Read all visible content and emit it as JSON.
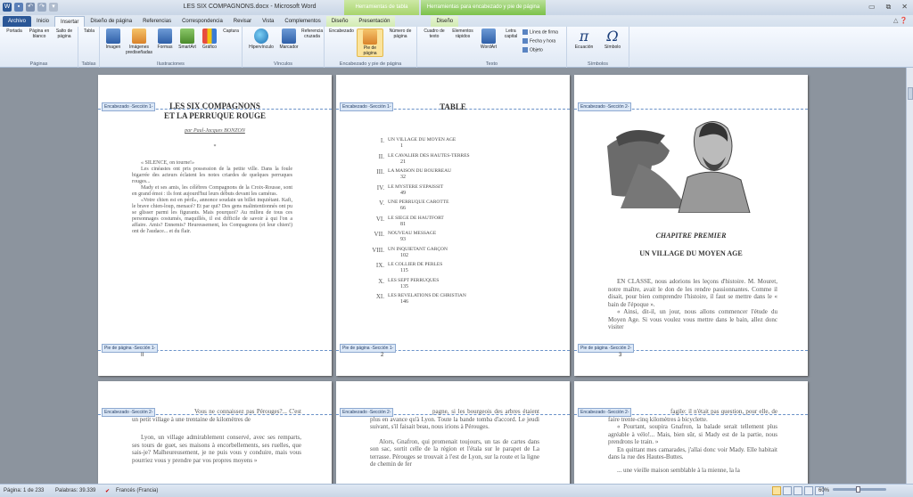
{
  "window": {
    "title": "LES SIX COMPAGNONS.docx - Microsoft Word",
    "context_tab_1": "Herramientas de tabla",
    "context_tab_2": "Herramientas para encabezado y pie de página",
    "controls": [
      "▭",
      "⧉",
      "✕"
    ]
  },
  "tabs": [
    "Archivo",
    "Inicio",
    "Insertar",
    "Diseño de página",
    "Referencias",
    "Correspondencia",
    "Revisar",
    "Vista",
    "Complementos",
    "Diseño",
    "Presentación",
    "Diseño"
  ],
  "ribbon": {
    "groups": [
      {
        "label": "Páginas"
      },
      {
        "label": "Tablas"
      },
      {
        "label": "Ilustraciones"
      },
      {
        "label": "Vínculos"
      },
      {
        "label": "Encabezado y pie de página"
      },
      {
        "label": "Texto"
      },
      {
        "label": "Símbolos"
      }
    ],
    "buttons": {
      "portada": "Portada",
      "pagina_blanco": "Página en blanco",
      "salto": "Salto de página",
      "tabla": "Tabla",
      "imagen": "Imagen",
      "imagenes_pred": "Imágenes prediseñadas",
      "formas": "Formas",
      "smartart": "SmartArt",
      "grafico": "Gráfico",
      "captura": "Captura",
      "hipervinculo": "Hipervínculo",
      "marcador": "Marcador",
      "referencia": "Referencia cruzada",
      "encabezado": "Encabezado",
      "pie_pagina": "Pie de página",
      "numero_pagina": "Número de página",
      "cuadro_texto": "Cuadro de texto",
      "elementos_rapidos": "Elementos rápidos",
      "wordart": "WordArt",
      "letra_capital": "Letra capital",
      "linea_firma": "Línea de firma",
      "fecha_hora": "Fecha y hora",
      "objeto": "Objeto",
      "ecuacion": "Ecuación",
      "simbolo": "Símbolo"
    }
  },
  "tags": {
    "header1": "Encabezado -Sección 1-",
    "header2": "Encabezado -Sección 2-",
    "footer1": "Pie de página -Sección 1-",
    "footer2": "Pie de página -Sección 2-"
  },
  "page1": {
    "title1": "LES SIX COMPAGNONS",
    "title2": "ET LA PERRUQUE ROUGE",
    "author": "par Paul-Jacques BONZON",
    "star": "*",
    "paras": [
      "« SILENCE, on tourne!»",
      "Les cinéastes ont pris possession de la petite ville. Dans la foule bigarrée des acteurs éclatent les notes criardes de quelques perruques rouges...",
      "Mady et ses amis, les célèbres Compagnons de la Croix-Rousse, sont en grand émoi : ils font aujourd'hui leurs débuts devant les caméras.",
      "«Votre chien est en péril», annonce soudain un billet inquiétant. Kafi, le brave chien-loup, menacé? Et par qui? Des gens malintentionnés ont pu se glisser parmi les figurants. Mais pourquoi? Au milieu de tous ces personnages costumés, maquillés, il est difficile de savoir à qui l'on a affaire. Amis? Ennemis? Heureusement, les Compagnons (et leur chien!) ont de l'audace... et du flair."
    ],
    "page_number": "II"
  },
  "page2": {
    "title": "TABLE",
    "toc": [
      {
        "n": "I.",
        "t": "UN VILLAGE DU MOYEN AGE",
        "p": "1"
      },
      {
        "n": "II.",
        "t": "LE CAVALIER DES HAUTES-TERRES",
        "p": "21"
      },
      {
        "n": "III.",
        "t": "LA MAISON DU BOURREAU",
        "p": "32"
      },
      {
        "n": "IV.",
        "t": "LE MYSTERE S'EPAISSIT",
        "p": "49"
      },
      {
        "n": "V.",
        "t": "UNE PERRUQUE CAROTTE",
        "p": "66"
      },
      {
        "n": "VI.",
        "t": "LE SIEGE DE HAUTFORT",
        "p": "81"
      },
      {
        "n": "VII.",
        "t": "NOUVEAU MESSAGE",
        "p": "93"
      },
      {
        "n": "VIII.",
        "t": "UN INQUIETANT GARÇON",
        "p": "102"
      },
      {
        "n": "IX.",
        "t": "LE COLLIER DE PERLES",
        "p": "115"
      },
      {
        "n": "X.",
        "t": "LES SEPT PERRUQUES",
        "p": "135"
      },
      {
        "n": "XI.",
        "t": "LES REVELATIONS DE CHRISTIAN",
        "p": "146"
      }
    ],
    "page_number": "2"
  },
  "page3": {
    "chapter": "CHAPITRE PREMIER",
    "subtitle": "UN VILLAGE DU MOYEN AGE",
    "text": "EN CLASSE, nous adorions les leçons d'histoire. M. Mouret, notre maître, avait le don de les rendre passionnantes. Comme il disait, pour bien comprendre l'histoire, il faut se mettre dans le « bain de l'époque ».",
    "text2": "« Ainsi, dit-il, un jour, nous allons commencer l'étude du Moyen Age. Si vous voulez vous mettre dans le bain, allez donc visiter",
    "page_number": "3"
  },
  "page4": {
    "text": "Vous ne connaissez pas Pérouges?... C'est un petit village à une trentaine de kilomètres de",
    "text2": "Lyon, un village admirablement conservé, avec ses remparts, ses tours de guet, ses maisons à encorbellements, ses ruelles, que sais-je? Malheureusement, je ne puis vous y conduire, mais vous pourriez vous y prendre par vos propres moyens »"
  },
  "page5": {
    "text": "pagne, si les bourgeois des arbres étaient plus en avance qu'à Lyon. Toute la bande tomba d'accord. Le jeudi suivant, s'il faisait beau, nous irions à Pérouges.",
    "text2": "Alors, Gnafron, qui promenait toujours, un tas de cartes dans son sac, sortit celle de la région et l'étala sur le parapet de La terrasse. Pérouges se trouvait à l'est de Lyon, sur la route et la ligne de chemin de fer"
  },
  "page6": {
    "text": "fagile: il n'était pas question, pour elle, de faire trente-cinq kilomètres à bicyclette.",
    "text2": "« Pourtant, soupira Gnafron, la balade serait tellement plus agréable à vélo!... Mais, bien sûr, si Mady est de la partie, nous prendrons le train. »",
    "text3": "En quittant mes camarades, j'allai donc voir Mady. Elle habitait dans la rue des Hautes-Buttes.",
    "text4": "... une vieille maison semblable à la mienne, la la"
  },
  "status": {
    "page": "Página: 1 de 233",
    "words": "Palabras: 39.339",
    "lang": "Francés (Francia)",
    "zoom": "60%"
  }
}
